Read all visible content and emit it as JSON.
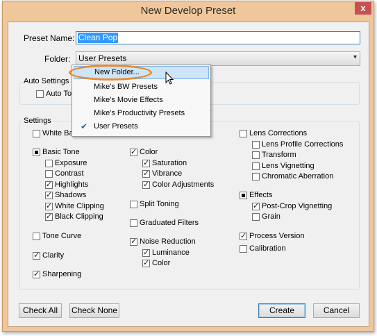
{
  "dialog": {
    "title": "New Develop Preset",
    "close_glyph": "x"
  },
  "preset_name": {
    "label": "Preset Name:",
    "value": "Clean Pop"
  },
  "folder": {
    "label": "Folder:",
    "value": "User Presets",
    "arrow": "▾"
  },
  "auto_settings": {
    "title": "Auto Settings",
    "auto_tone": {
      "label": "Auto Tone",
      "checked": false
    }
  },
  "settings": {
    "title": "Settings",
    "white_balance": {
      "label": "White Balance",
      "checked": false
    },
    "basic_tone": {
      "label": "Basic Tone",
      "state": "mixed"
    },
    "exposure": {
      "label": "Exposure",
      "checked": false
    },
    "contrast": {
      "label": "Contrast",
      "checked": false
    },
    "highlights": {
      "label": "Highlights",
      "checked": true
    },
    "shadows": {
      "label": "Shadows",
      "checked": true
    },
    "white_clipping": {
      "label": "White Clipping",
      "checked": true
    },
    "black_clipping": {
      "label": "Black Clipping",
      "checked": true
    },
    "tone_curve": {
      "label": "Tone Curve",
      "checked": false
    },
    "clarity": {
      "label": "Clarity",
      "checked": true
    },
    "sharpening": {
      "label": "Sharpening",
      "checked": true
    },
    "color": {
      "label": "Color",
      "checked": true
    },
    "saturation": {
      "label": "Saturation",
      "checked": true
    },
    "vibrance": {
      "label": "Vibrance",
      "checked": true
    },
    "color_adjustments": {
      "label": "Color Adjustments",
      "checked": true
    },
    "split_toning": {
      "label": "Split Toning",
      "checked": false
    },
    "graduated_filters": {
      "label": "Graduated Filters",
      "checked": false
    },
    "noise_reduction": {
      "label": "Noise Reduction",
      "checked": true
    },
    "luminance": {
      "label": "Luminance",
      "checked": true
    },
    "nr_color": {
      "label": "Color",
      "checked": true
    },
    "lens_corrections": {
      "label": "Lens Corrections",
      "checked": false
    },
    "lens_profile_corrections": {
      "label": "Lens Profile Corrections",
      "checked": false
    },
    "transform": {
      "label": "Transform",
      "checked": false
    },
    "lens_vignetting": {
      "label": "Lens Vignetting",
      "checked": false
    },
    "chromatic_aberration": {
      "label": "Chromatic Aberration",
      "checked": false
    },
    "effects": {
      "label": "Effects",
      "state": "mixed"
    },
    "post_crop_vignetting": {
      "label": "Post-Crop Vignetting",
      "checked": true
    },
    "grain": {
      "label": "Grain",
      "checked": false
    },
    "process_version": {
      "label": "Process Version",
      "checked": true
    },
    "calibration": {
      "label": "Calibration",
      "checked": false
    }
  },
  "folder_dropdown": {
    "items": [
      {
        "label": "New Folder...",
        "highlighted": true,
        "checked": false
      },
      {
        "label": "Mike's BW Presets",
        "highlighted": false,
        "checked": false
      },
      {
        "label": "Mike's Movie Effects",
        "highlighted": false,
        "checked": false
      },
      {
        "label": "Mike's Productivity Presets",
        "highlighted": false,
        "checked": false
      },
      {
        "label": "User Presets",
        "highlighted": false,
        "checked": true
      }
    ],
    "check_glyph": "✔"
  },
  "buttons": {
    "check_all": "Check All",
    "check_none": "Check None",
    "create": "Create",
    "cancel": "Cancel"
  },
  "colors": {
    "accent": "#3399ff",
    "title_bar": "#f0c79a",
    "callout_ring": "#e88a36",
    "close_button": "#c75050",
    "menu_highlight": "#cde5f7"
  }
}
